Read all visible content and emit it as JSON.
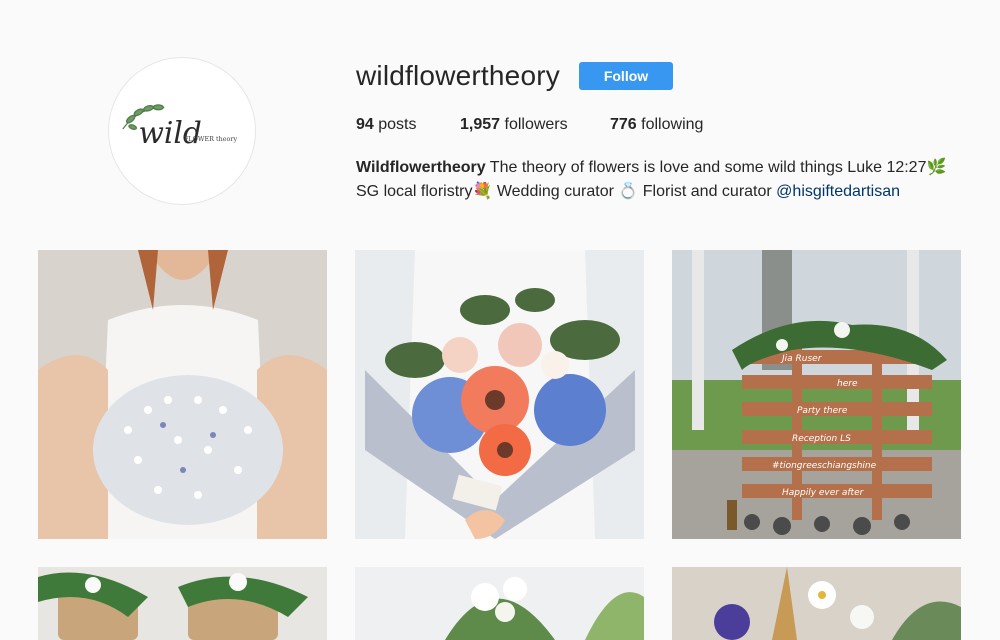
{
  "profile": {
    "username": "wildflowertheory",
    "follow_label": "Follow",
    "logo_text": "wild",
    "logo_subtext": "FLOWER theory",
    "stats": {
      "posts_count": "94",
      "posts_label": "posts",
      "followers_count": "1,957",
      "followers_label": "followers",
      "following_count": "776",
      "following_label": "following"
    },
    "bio": {
      "name": "Wildflowertheory",
      "line1": "The theory of flowers is love and some wild things Luke 12:27",
      "emoji_herb": "🌿",
      "line2_a": "SG local floristry",
      "emoji_bouquet": "💐",
      "line2_b": "Wedding curator",
      "emoji_ring": "💍",
      "line2_c": "Florist and curator",
      "mention": "@hisgiftedartisan"
    }
  },
  "sign_lines": [
    "Jia Ruser",
    "here",
    "Party there",
    "Reception LS",
    "#tiongreeschiangshine",
    "Happily ever after"
  ],
  "posts": [
    {
      "icon": "baby-breath-bouquet-photo"
    },
    {
      "icon": "gerbera-hydrangea-bouquet-photo"
    },
    {
      "icon": "wooden-sign-photo"
    },
    {
      "icon": "wedding-chairs-photo"
    },
    {
      "icon": "white-flower-arrangement-photo"
    },
    {
      "icon": "daisy-arrangement-photo"
    }
  ],
  "colors": {
    "follow_button": "#3897f0",
    "mention": "#003569",
    "background": "#fafafa"
  }
}
